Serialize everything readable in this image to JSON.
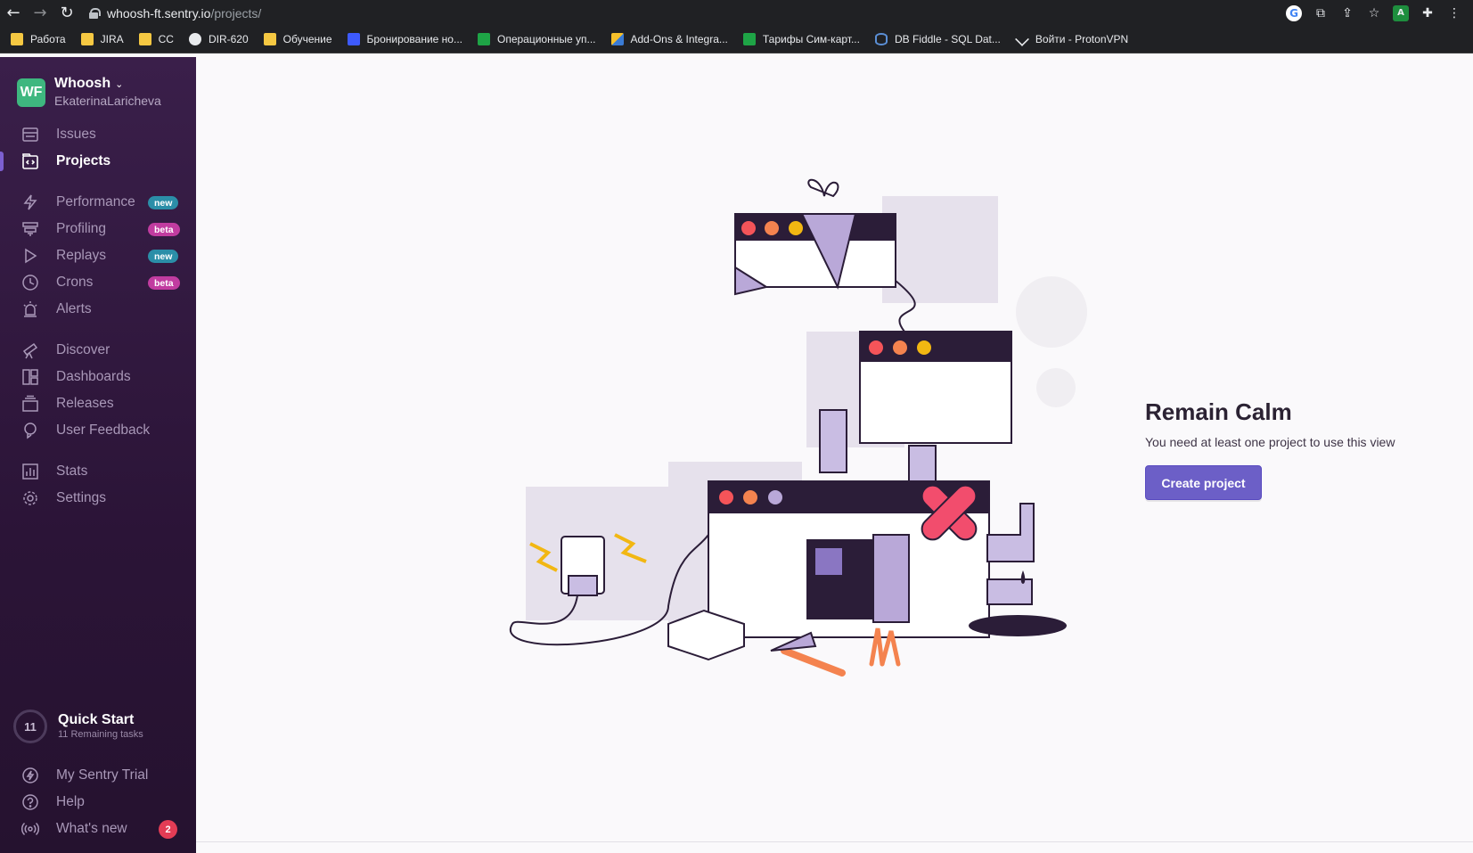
{
  "browser": {
    "url_host": "whoosh-ft.sentry.io",
    "url_path": "/projects/",
    "bookmarks": [
      {
        "label": "Работа",
        "icon": "folder-icon"
      },
      {
        "label": "JIRA",
        "icon": "folder-icon"
      },
      {
        "label": "CC",
        "icon": "folder-icon"
      },
      {
        "label": "DIR-620",
        "icon": "globe-icon"
      },
      {
        "label": "Обучение",
        "icon": "folder-icon"
      },
      {
        "label": "Бронирование но...",
        "icon": "calendar-icon"
      },
      {
        "label": "Операционные уп...",
        "icon": "sheets-icon"
      },
      {
        "label": "Add-Ons & Integra...",
        "icon": "addons-icon"
      },
      {
        "label": "Тарифы Сим-карт...",
        "icon": "sheets-icon"
      },
      {
        "label": "DB Fiddle - SQL Dat...",
        "icon": "database-icon"
      },
      {
        "label": "Войти - ProtonVPN",
        "icon": "proton-icon"
      }
    ]
  },
  "sidebar": {
    "org_initials": "WF",
    "org_name": "Whoosh",
    "org_user": "EkaterinaLaricheva",
    "items": [
      {
        "label": "Issues"
      },
      {
        "label": "Projects"
      },
      {
        "label": "Performance",
        "badge": "new"
      },
      {
        "label": "Profiling",
        "badge": "beta"
      },
      {
        "label": "Replays",
        "badge": "new"
      },
      {
        "label": "Crons",
        "badge": "beta"
      },
      {
        "label": "Alerts"
      },
      {
        "label": "Discover"
      },
      {
        "label": "Dashboards"
      },
      {
        "label": "Releases"
      },
      {
        "label": "User Feedback"
      },
      {
        "label": "Stats"
      },
      {
        "label": "Settings"
      }
    ],
    "quickstart": {
      "count": "11",
      "title": "Quick Start",
      "subtitle": "11 Remaining tasks"
    },
    "bottom": [
      {
        "label": "My Sentry Trial"
      },
      {
        "label": "Help"
      },
      {
        "label": "What's new",
        "count": "2"
      }
    ]
  },
  "empty_state": {
    "title": "Remain Calm",
    "description": "You need at least one project to use this view",
    "button_label": "Create project"
  },
  "colors": {
    "accent": "#6c5fc7",
    "sidebar_bg": "#2b1437",
    "org_avatar": "#3eb77f",
    "badge_new": "#2b8ea8",
    "badge_beta": "#c13ca0",
    "notification": "#e33c55"
  }
}
